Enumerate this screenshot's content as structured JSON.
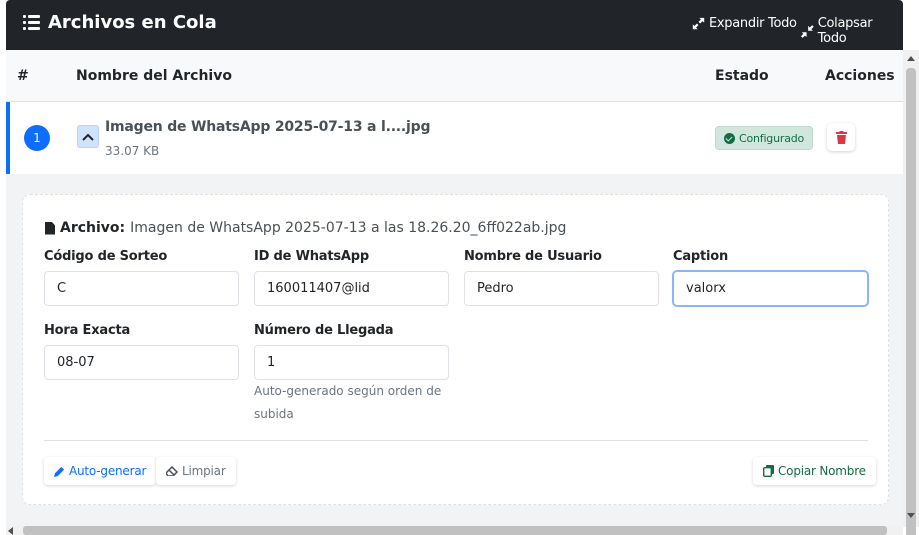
{
  "header": {
    "title": "Archivos en Cola",
    "expand_label": "Expandir Todo",
    "collapse_label": "Colapsar Todo"
  },
  "table": {
    "columns": [
      "#",
      "Nombre del Archivo",
      "Estado",
      "Acciones"
    ]
  },
  "row": {
    "number": "1",
    "file_name": "Imagen de WhatsApp 2025-07-13 a l....jpg",
    "file_size": "33.07 KB",
    "status": "Configurado"
  },
  "detail": {
    "file_label": "Archivo:",
    "file_full_name": "Imagen de WhatsApp 2025-07-13 a las 18.26.20_6ff022ab.jpg",
    "fields": {
      "codigo_sorteo": {
        "label": "Código de Sorteo",
        "value": "C"
      },
      "id_whatsapp": {
        "label": "ID de WhatsApp",
        "value": "160011407@lid"
      },
      "nombre_usuario": {
        "label": "Nombre de Usuario",
        "value": "Pedro"
      },
      "caption": {
        "label": "Caption",
        "value": "valorx"
      },
      "hora_exacta": {
        "label": "Hora Exacta",
        "value": "08-07"
      },
      "numero_llegada": {
        "label": "Número de Llegada",
        "value": "1",
        "help_line1": "Auto-generado según orden de",
        "help_line2": "subida"
      }
    },
    "buttons": {
      "auto_generar": "Auto-generar",
      "limpiar": "Limpiar",
      "copiar_nombre": "Copiar Nombre"
    }
  },
  "colors": {
    "primary": "#0d6efd",
    "danger": "#dc3545",
    "success": "#146c43",
    "header_bg": "#212529"
  },
  "icons": [
    "list-icon",
    "expand-icon",
    "collapse-icon",
    "chevron-up-icon",
    "check-circle-icon",
    "trash-icon",
    "file-icon",
    "pencil-icon",
    "eraser-icon",
    "copy-icon"
  ]
}
